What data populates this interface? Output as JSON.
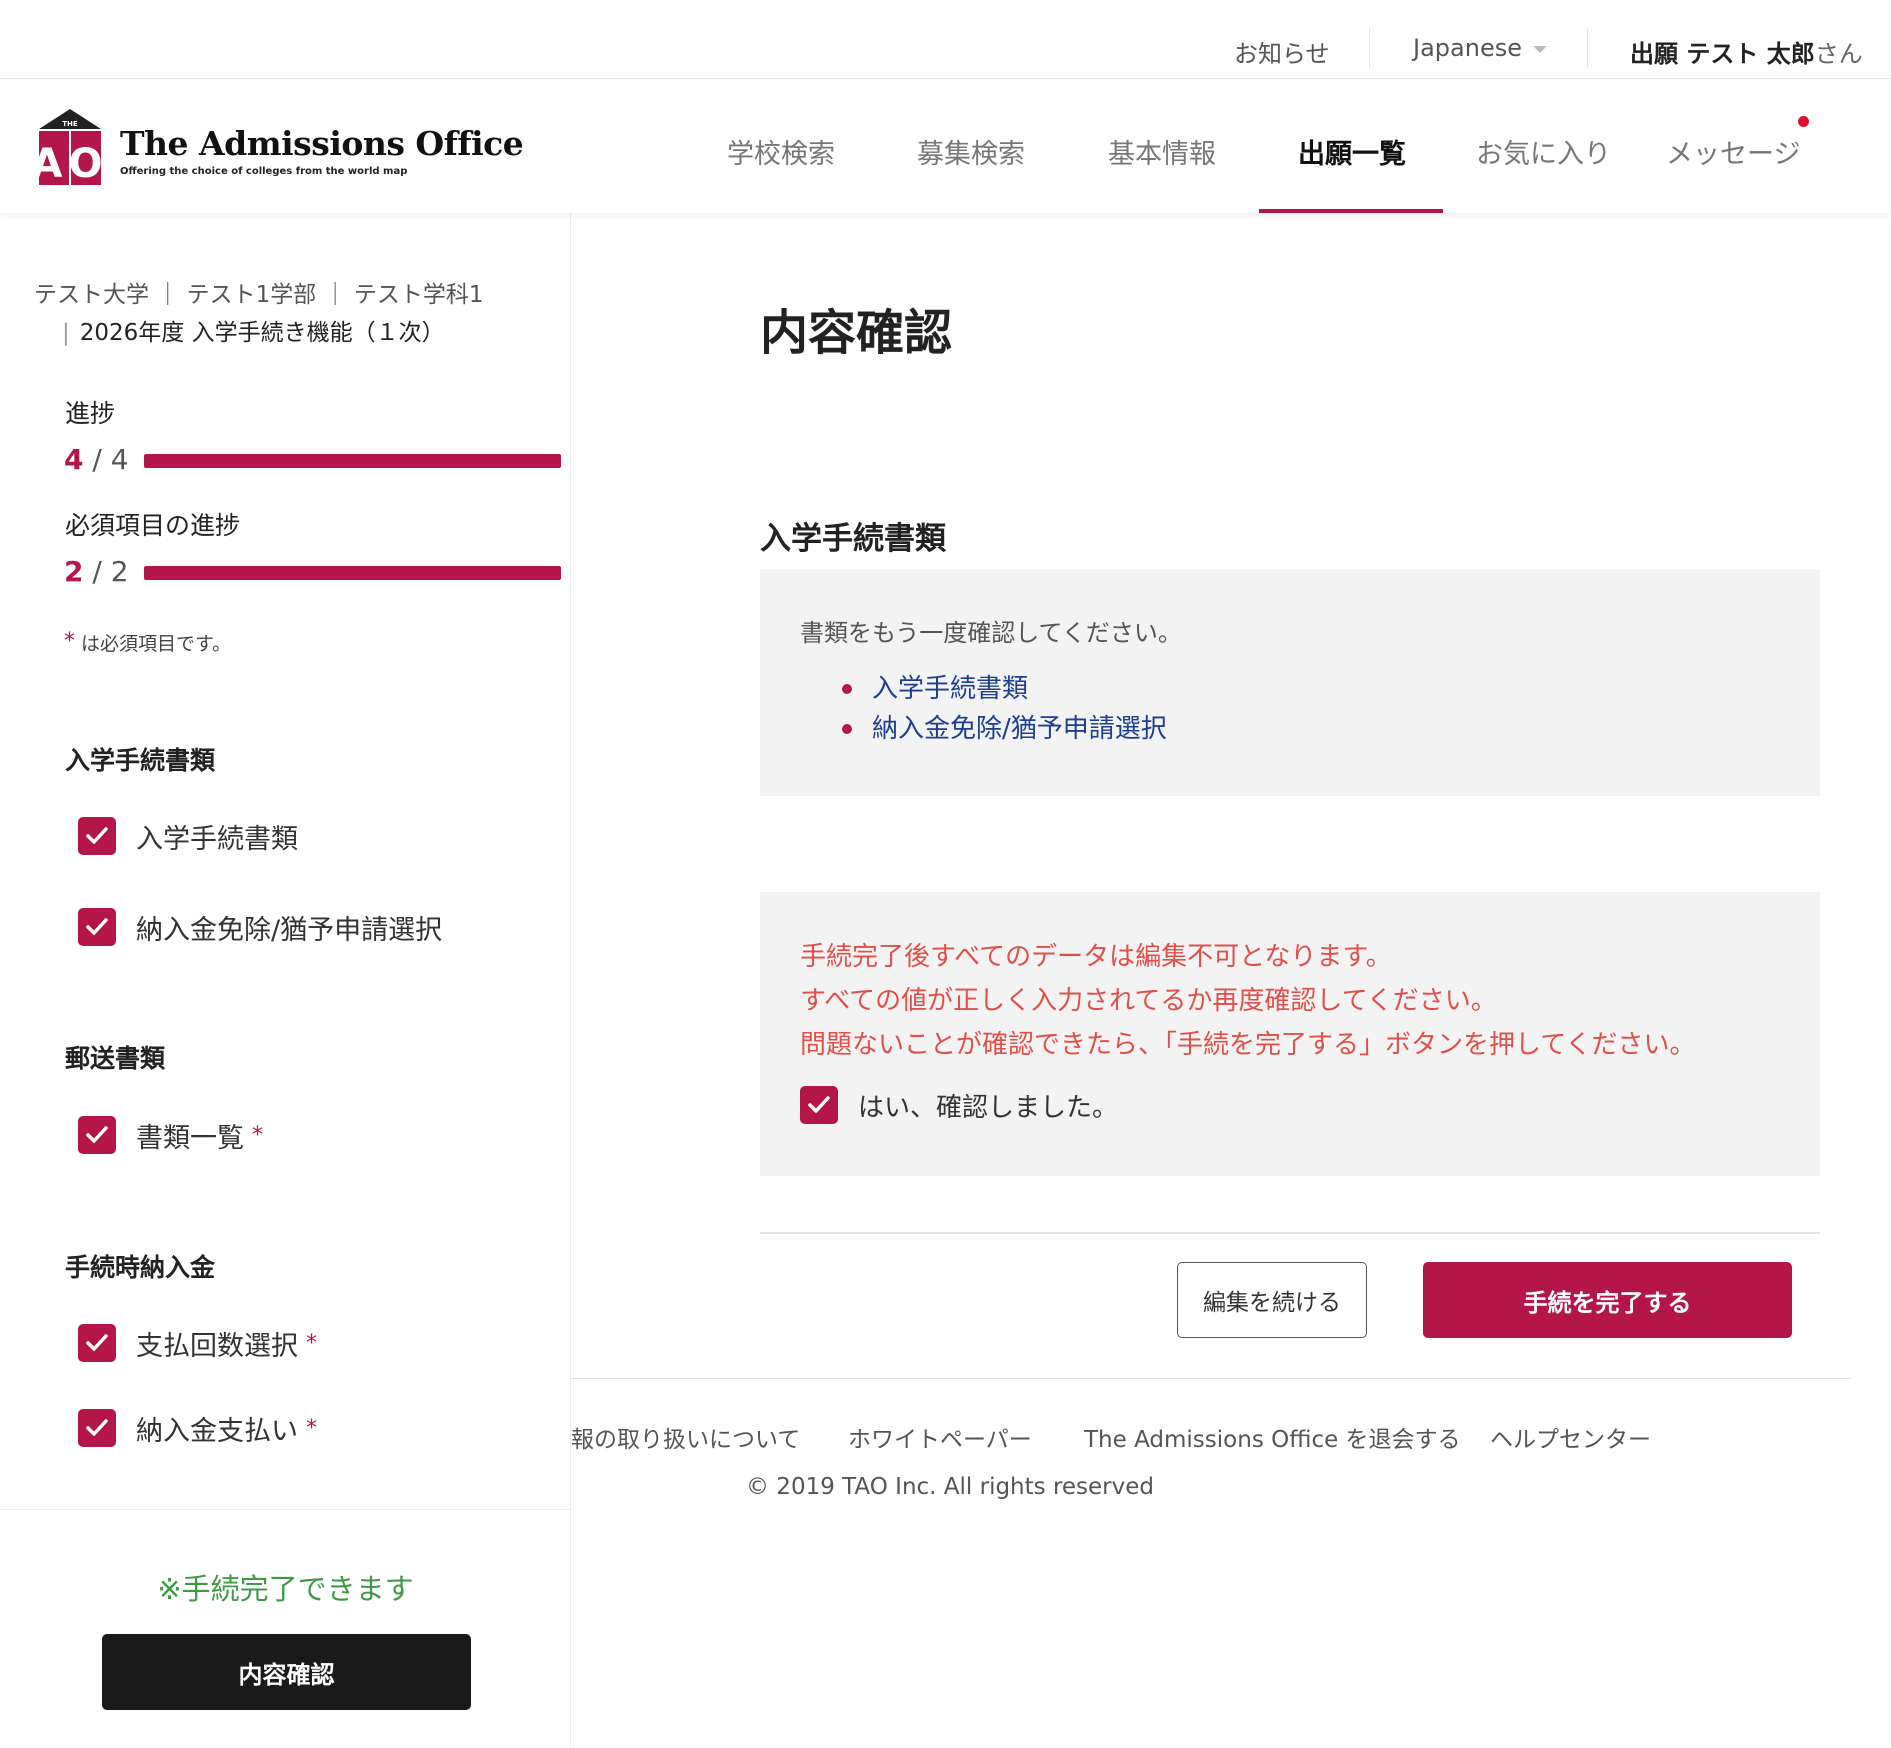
{
  "topbar": {
    "news": "お知らせ",
    "language": "Japanese",
    "user_name": "出願 テスト 太郎",
    "user_suffix": "さん"
  },
  "brand": {
    "logo_letters": "AO",
    "logo_roof": "THE",
    "title": "The Admissions Office",
    "tagline": "Offering the choice of colleges from the world map"
  },
  "nav": {
    "items": [
      {
        "label": "学校検索"
      },
      {
        "label": "募集検索"
      },
      {
        "label": "基本情報"
      },
      {
        "label": "出願一覧",
        "active": true
      },
      {
        "label": "お気に入り"
      },
      {
        "label": "メッセージ",
        "has_notification": true
      }
    ]
  },
  "sidebar": {
    "breadcrumb_line1": "テスト大学 ｜ テスト1学部 ｜ テスト学科1",
    "breadcrumb_line2": "2026年度 入学手続き機能（１次）",
    "progress": {
      "label": "進捗",
      "current": "4",
      "total": "4",
      "fraction": 1.0
    },
    "required_progress": {
      "label": "必須項目の進捗",
      "current": "2",
      "total": "2",
      "fraction": 1.0
    },
    "required_note": "は必須項目です。",
    "sections": [
      {
        "title": "入学手続書類",
        "items": [
          {
            "label": "入学手続書類",
            "checked": true,
            "required": false
          },
          {
            "label": "納入金免除/猶予申請選択",
            "checked": true,
            "required": false
          }
        ]
      },
      {
        "title": "郵送書類",
        "items": [
          {
            "label": "書類一覧",
            "checked": true,
            "required": true
          }
        ]
      },
      {
        "title": "手続時納入金",
        "items": [
          {
            "label": "支払回数選択",
            "checked": true,
            "required": true
          },
          {
            "label": "納入金支払い",
            "checked": true,
            "required": true
          }
        ]
      }
    ],
    "complete_status": "※手続完了できます",
    "confirm_button": "内容確認"
  },
  "main": {
    "page_title": "内容確認",
    "section_title": "入学手続書類",
    "doc_intro": "書類をもう一度確認してください。",
    "doc_links": [
      "入学手続書類",
      "納入金免除/猶予申請選択"
    ],
    "warning_lines": [
      "手続完了後すべてのデータは編集不可となります。",
      "すべての値が正しく入力されてるか再度確認してください。",
      "問題ないことが確認できたら、「手続を完了する」ボタンを押してください。"
    ],
    "confirm_checkbox_label": "はい、確認しました。",
    "confirm_checked": true,
    "edit_button": "編集を続ける",
    "complete_button": "手続を完了する"
  },
  "footer": {
    "links": [
      "報の取り扱いについて",
      "ホワイトペーパー",
      "The Admissions Office を退会する",
      "ヘルプセンター"
    ],
    "copyright": "© 2019 TAO Inc. All rights reserved"
  },
  "colors": {
    "accent": "#b5164a",
    "warning_text": "#e0504a",
    "success_text": "#3d9a45",
    "link": "#1e3f8f"
  }
}
